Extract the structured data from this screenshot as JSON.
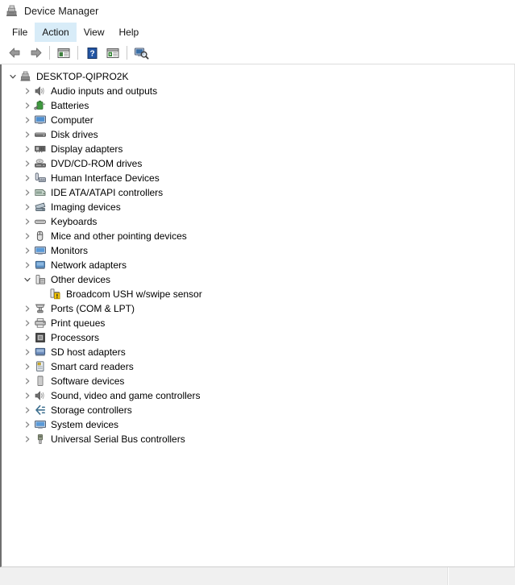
{
  "window": {
    "title": "Device Manager",
    "icon": "device-manager-icon"
  },
  "menubar": {
    "items": [
      {
        "label": "File",
        "active": false
      },
      {
        "label": "Action",
        "active": true
      },
      {
        "label": "View",
        "active": false
      },
      {
        "label": "Help",
        "active": false
      }
    ]
  },
  "toolbar": {
    "buttons": [
      {
        "name": "back-arrow-icon",
        "tooltip": "Back"
      },
      {
        "name": "forward-arrow-icon",
        "tooltip": "Forward"
      },
      {
        "name": "separator"
      },
      {
        "name": "properties-icon",
        "tooltip": "Properties"
      },
      {
        "name": "separator"
      },
      {
        "name": "help-icon",
        "tooltip": "Help"
      },
      {
        "name": "update-driver-icon",
        "tooltip": "Update Driver Software"
      },
      {
        "name": "separator"
      },
      {
        "name": "scan-hardware-changes-icon",
        "tooltip": "Scan for hardware changes"
      }
    ]
  },
  "tree": {
    "nodes": [
      {
        "label": "DESKTOP-QIPRO2K",
        "level": 0,
        "state": "expanded",
        "icon": "computer-tower-icon"
      },
      {
        "label": "Audio inputs and outputs",
        "level": 1,
        "state": "collapsed",
        "icon": "speaker-icon"
      },
      {
        "label": "Batteries",
        "level": 1,
        "state": "collapsed",
        "icon": "battery-icon"
      },
      {
        "label": "Computer",
        "level": 1,
        "state": "collapsed",
        "icon": "monitor-icon"
      },
      {
        "label": "Disk drives",
        "level": 1,
        "state": "collapsed",
        "icon": "disk-drive-icon"
      },
      {
        "label": "Display adapters",
        "level": 1,
        "state": "collapsed",
        "icon": "display-adapter-icon"
      },
      {
        "label": "DVD/CD-ROM drives",
        "level": 1,
        "state": "collapsed",
        "icon": "optical-drive-icon"
      },
      {
        "label": "Human Interface Devices",
        "level": 1,
        "state": "collapsed",
        "icon": "hid-icon"
      },
      {
        "label": "IDE ATA/ATAPI controllers",
        "level": 1,
        "state": "collapsed",
        "icon": "ide-controller-icon"
      },
      {
        "label": "Imaging devices",
        "level": 1,
        "state": "collapsed",
        "icon": "imaging-device-icon"
      },
      {
        "label": "Keyboards",
        "level": 1,
        "state": "collapsed",
        "icon": "keyboard-icon"
      },
      {
        "label": "Mice and other pointing devices",
        "level": 1,
        "state": "collapsed",
        "icon": "mouse-icon"
      },
      {
        "label": "Monitors",
        "level": 1,
        "state": "collapsed",
        "icon": "monitor-icon"
      },
      {
        "label": "Network adapters",
        "level": 1,
        "state": "collapsed",
        "icon": "network-adapter-icon"
      },
      {
        "label": "Other devices",
        "level": 1,
        "state": "expanded",
        "icon": "unknown-device-icon"
      },
      {
        "label": "Broadcom USH w/swipe sensor",
        "level": 2,
        "state": "leaf",
        "icon": "unknown-device-warning-icon",
        "warning": true
      },
      {
        "label": "Ports (COM & LPT)",
        "level": 1,
        "state": "collapsed",
        "icon": "port-icon"
      },
      {
        "label": "Print queues",
        "level": 1,
        "state": "collapsed",
        "icon": "printer-icon"
      },
      {
        "label": "Processors",
        "level": 1,
        "state": "collapsed",
        "icon": "processor-icon"
      },
      {
        "label": "SD host adapters",
        "level": 1,
        "state": "collapsed",
        "icon": "sd-adapter-icon"
      },
      {
        "label": "Smart card readers",
        "level": 1,
        "state": "collapsed",
        "icon": "smartcard-reader-icon"
      },
      {
        "label": "Software devices",
        "level": 1,
        "state": "collapsed",
        "icon": "software-device-icon"
      },
      {
        "label": "Sound, video and game controllers",
        "level": 1,
        "state": "collapsed",
        "icon": "speaker-icon"
      },
      {
        "label": "Storage controllers",
        "level": 1,
        "state": "collapsed",
        "icon": "storage-controller-icon"
      },
      {
        "label": "System devices",
        "level": 1,
        "state": "collapsed",
        "icon": "monitor-icon"
      },
      {
        "label": "Universal Serial Bus controllers",
        "level": 1,
        "state": "collapsed",
        "icon": "usb-icon"
      }
    ]
  },
  "statusbar": {
    "left_text": "",
    "right_text": ""
  },
  "colors": {
    "menu_highlight": "#d8ecf8",
    "warning_badge": "#f5c518",
    "panel_border": "#6f6f6f",
    "statusbar_bg": "#f0f0f0"
  }
}
